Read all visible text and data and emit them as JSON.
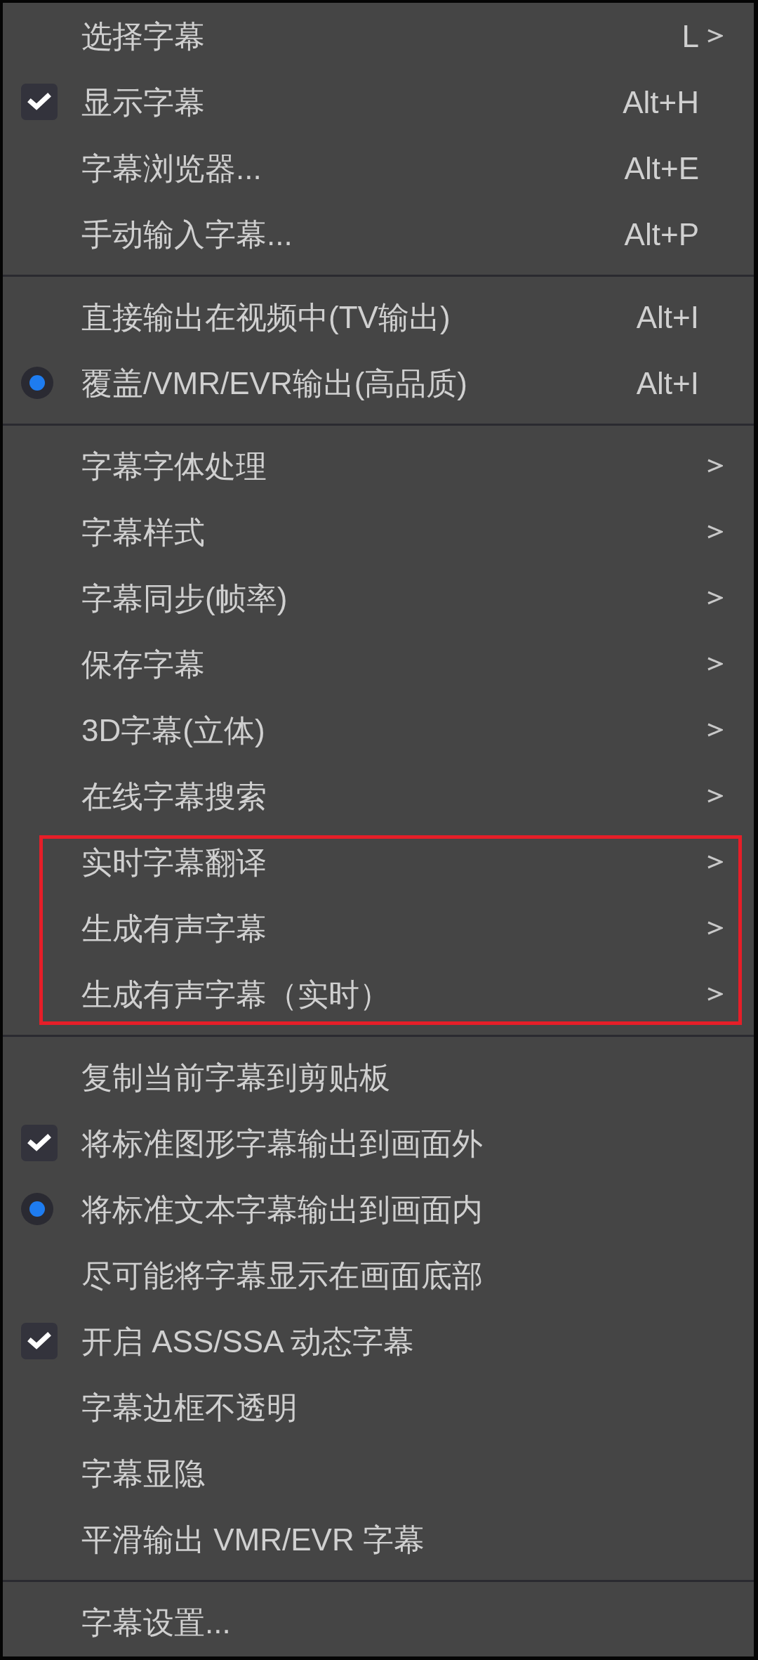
{
  "menu": {
    "sections": [
      {
        "items": [
          {
            "label": "选择字幕",
            "shortcut": "L",
            "kind": "submenu",
            "checked": false,
            "highlighted": false
          },
          {
            "label": "显示字幕",
            "shortcut": "Alt+H",
            "kind": "check",
            "checked": true,
            "highlighted": false
          },
          {
            "label": "字幕浏览器...",
            "shortcut": "Alt+E",
            "kind": "command",
            "checked": false,
            "highlighted": false
          },
          {
            "label": "手动输入字幕...",
            "shortcut": "Alt+P",
            "kind": "command",
            "checked": false,
            "highlighted": false
          }
        ]
      },
      {
        "items": [
          {
            "label": "直接输出在视频中(TV输出)",
            "shortcut": "Alt+I",
            "kind": "radio",
            "checked": false,
            "highlighted": false
          },
          {
            "label": "覆盖/VMR/EVR输出(高品质)",
            "shortcut": "Alt+I",
            "kind": "radio",
            "checked": true,
            "highlighted": false
          }
        ]
      },
      {
        "items": [
          {
            "label": "字幕字体处理",
            "kind": "submenu",
            "checked": false,
            "highlighted": false
          },
          {
            "label": "字幕样式",
            "kind": "submenu",
            "checked": false,
            "highlighted": false
          },
          {
            "label": "字幕同步(帧率)",
            "kind": "submenu",
            "checked": false,
            "highlighted": false
          },
          {
            "label": "保存字幕",
            "kind": "submenu",
            "checked": false,
            "highlighted": false
          },
          {
            "label": "3D字幕(立体)",
            "kind": "submenu",
            "checked": false,
            "highlighted": false
          },
          {
            "label": "在线字幕搜索",
            "kind": "submenu",
            "checked": false,
            "highlighted": false
          },
          {
            "label": "实时字幕翻译",
            "kind": "submenu",
            "checked": false,
            "highlighted": true
          },
          {
            "label": "生成有声字幕",
            "kind": "submenu",
            "checked": false,
            "highlighted": true
          },
          {
            "label": "生成有声字幕（实时）",
            "kind": "submenu",
            "checked": false,
            "highlighted": true
          }
        ]
      },
      {
        "items": [
          {
            "label": "复制当前字幕到剪贴板",
            "kind": "check",
            "checked": false,
            "highlighted": false
          },
          {
            "label": "将标准图形字幕输出到画面外",
            "kind": "check",
            "checked": true,
            "highlighted": false
          },
          {
            "label": "将标准文本字幕输出到画面内",
            "kind": "radio",
            "checked": true,
            "highlighted": false
          },
          {
            "label": "尽可能将字幕显示在画面底部",
            "kind": "check",
            "checked": false,
            "highlighted": false
          },
          {
            "label": "开启 ASS/SSA 动态字幕",
            "kind": "check",
            "checked": true,
            "highlighted": false
          },
          {
            "label": "字幕边框不透明",
            "kind": "check",
            "checked": false,
            "highlighted": false
          },
          {
            "label": "字幕显隐",
            "kind": "check",
            "checked": false,
            "highlighted": false
          },
          {
            "label": "平滑输出 VMR/EVR 字幕",
            "kind": "check",
            "checked": false,
            "highlighted": false
          }
        ]
      },
      {
        "items": [
          {
            "label": "字幕设置...",
            "kind": "command",
            "checked": false,
            "highlighted": false
          }
        ]
      }
    ]
  }
}
